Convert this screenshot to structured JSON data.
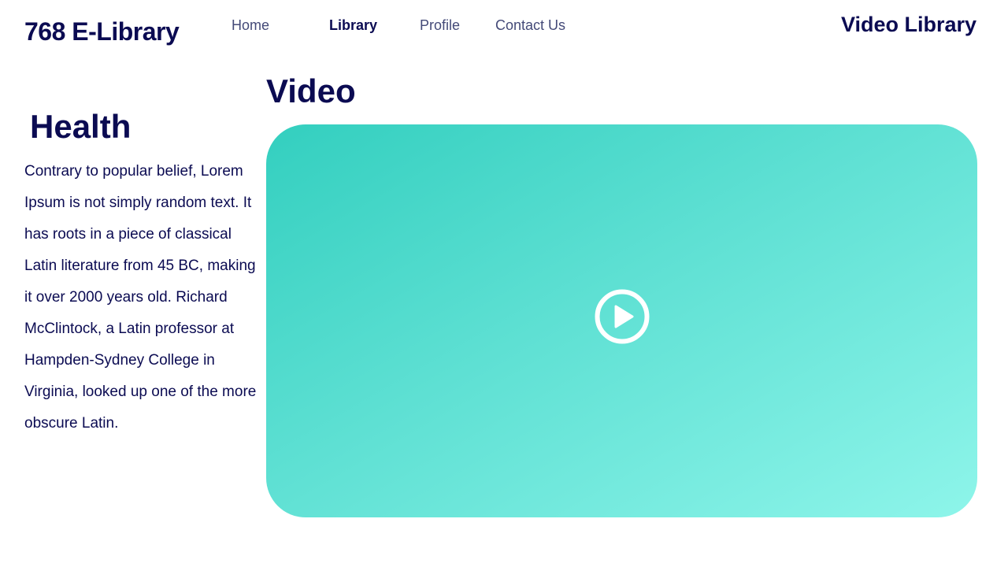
{
  "brand": {
    "title": "768 E-Library"
  },
  "nav": {
    "items": [
      {
        "label": "Home"
      },
      {
        "label": "Library"
      },
      {
        "label": "Profile"
      },
      {
        "label": "Contact Us"
      }
    ],
    "active": "Library"
  },
  "header": {
    "section_title": "Video Library"
  },
  "sidebar": {
    "heading": "Health",
    "body": "Contrary to popular belief, Lorem Ipsum is not simply random text. It has roots in a piece of classical Latin literature from 45 BC, making it over 2000 years old. Richard McClintock, a Latin professor at Hampden-Sydney College in Virginia, looked up one of the more obscure Latin."
  },
  "main": {
    "heading": "Video",
    "player": {
      "play_icon": "play-circle-icon",
      "gradient_start": "#33cfbf",
      "gradient_end": "#8ef5ea"
    }
  },
  "colors": {
    "primary_text": "#0b0b52",
    "nav_text": "#444a78",
    "background": "#ffffff"
  }
}
